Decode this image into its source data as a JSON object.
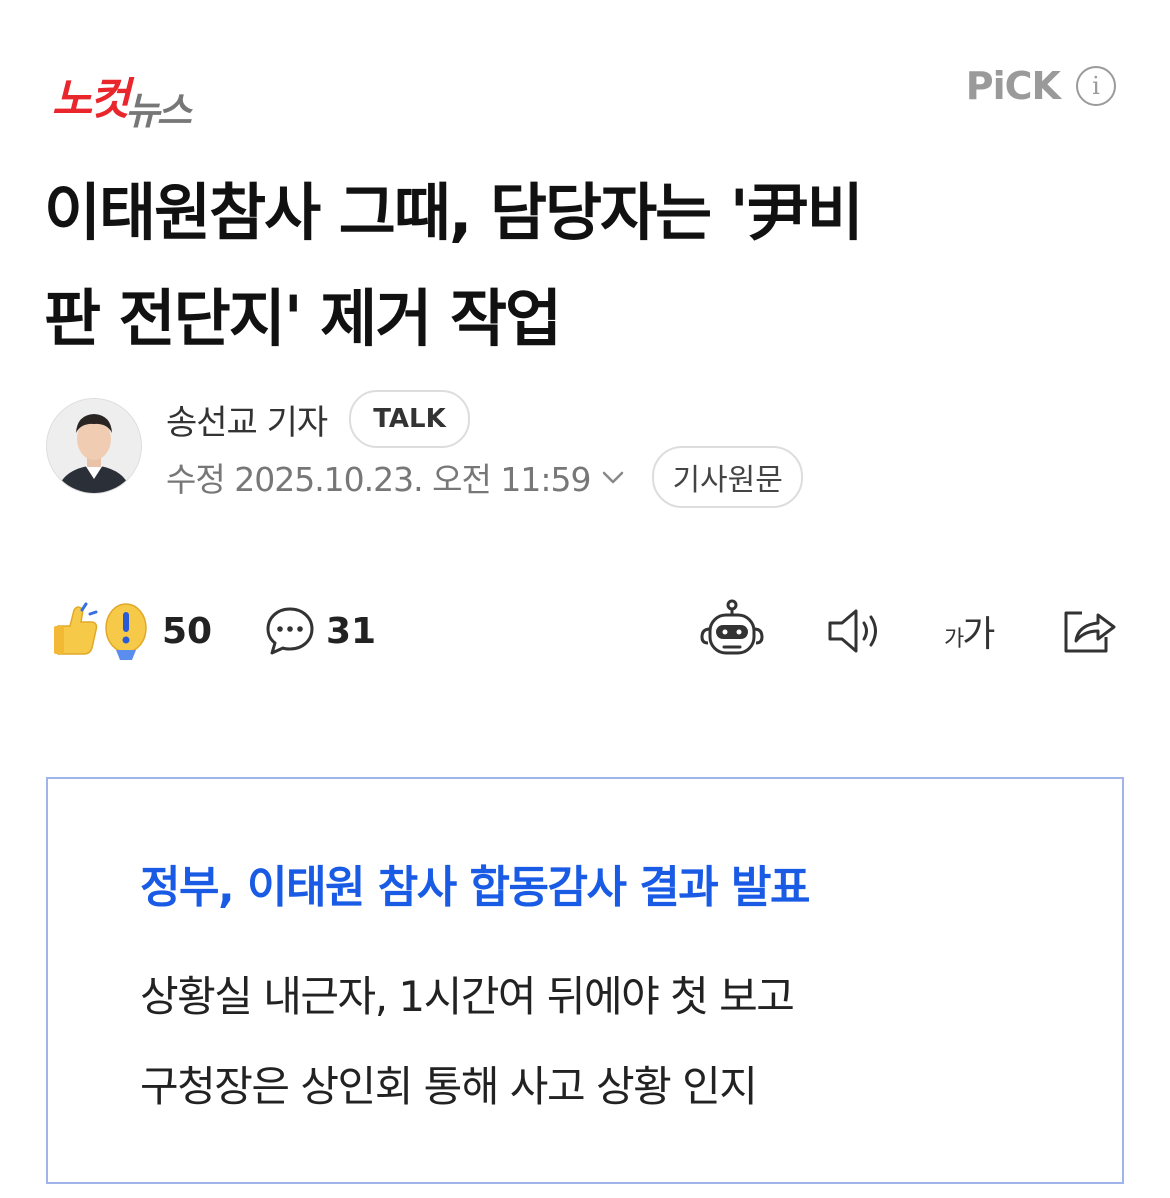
{
  "header": {
    "logo_red": "노컷",
    "logo_gray": "뉴스",
    "pick_label": "PiCK",
    "info_symbol": "i"
  },
  "article": {
    "headline_line1": "이태원참사 그때, 담당자는 '尹비",
    "headline_line2": "판 전단지' 제거 작업"
  },
  "reporter": {
    "name": "송선교 기자",
    "talk_label": "TALK",
    "modified": "수정 2025.10.23. 오전 11:59",
    "original_label": "기사원문"
  },
  "actions": {
    "reaction_count": "50",
    "comment_count": "31",
    "font_size_small": "가",
    "font_size_large": "가",
    "icons": [
      "reaction-icon",
      "comment-icon",
      "ai-robot-icon",
      "speaker-icon",
      "font-size-icon",
      "share-icon"
    ]
  },
  "summary": {
    "title": "정부, 이태원 참사 합동감사 결과 발표",
    "lines": [
      "상황실 내근자, 1시간여 뒤에야 첫 보고",
      "구청장은 상인회 통해 사고 상황 인지"
    ]
  },
  "colors": {
    "brand_red": "#e8262c",
    "summary_blue": "#1a5be6",
    "summary_border": "#9fb5ea"
  }
}
